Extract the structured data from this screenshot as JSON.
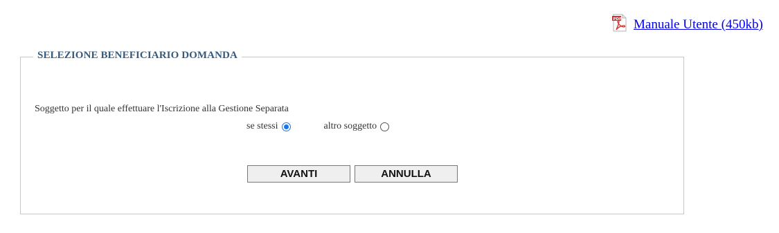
{
  "header": {
    "manual_link": "Manuale Utente (450kb)",
    "manual_icon": "pdf-file-icon",
    "pdf_badge": "PDF"
  },
  "form": {
    "legend": "SELEZIONE BENEFICIARIO DOMANDA",
    "question": "Soggetto per il quale effettuare l'Iscrizione alla Gestione Separata",
    "options": [
      {
        "label": "se stessi",
        "checked": true
      },
      {
        "label": "altro soggetto",
        "checked": false
      }
    ],
    "buttons": {
      "next": "AVANTI",
      "cancel": "ANNULLA"
    }
  },
  "colors": {
    "legend": "#365b7e",
    "link": "#0000ee",
    "radio_selected": "#1a73e8",
    "pdf_red": "#d32f2f"
  }
}
